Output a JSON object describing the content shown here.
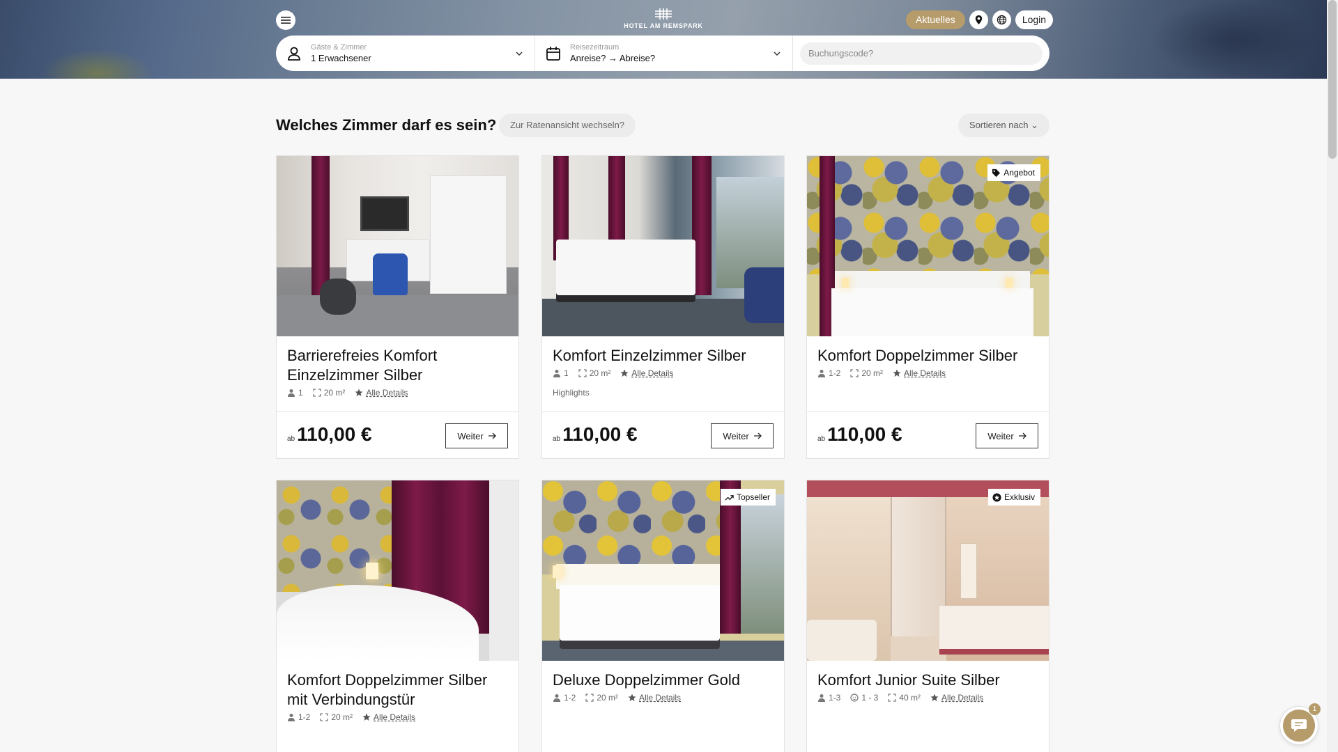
{
  "header": {
    "logo_text": "HOTEL AM REMSPARK",
    "aktuelles_label": "Aktuelles",
    "login_label": "Login",
    "accent_color": "#b69b6b"
  },
  "search": {
    "guests_label": "Gäste & Zimmer",
    "guests_value": "1 Erwachsener",
    "dates_label": "Reisezeitraum",
    "dates_value": "Anreise? → Abreise?",
    "code_placeholder": "Buchungscode?"
  },
  "main": {
    "title": "Welches Zimmer darf es sein?",
    "rate_toggle": "Zur Ratenansicht wechseln?",
    "sort_label": "Sortieren nach"
  },
  "rooms": [
    {
      "name": "Barrierefreies Komfort Einzelzimmer Silber",
      "guests": "1",
      "size": "20 m²",
      "details": "Alle Details",
      "highlights": "",
      "price_prefix": "ab",
      "price": "110,00 €",
      "button": "Weiter",
      "badge": ""
    },
    {
      "name": "Komfort Einzelzimmer Silber",
      "guests": "1",
      "size": "20 m²",
      "details": "Alle Details",
      "highlights": "Highlights",
      "price_prefix": "ab",
      "price": "110,00 €",
      "button": "Weiter",
      "badge": ""
    },
    {
      "name": "Komfort Doppelzimmer Silber",
      "guests": "1-2",
      "size": "20 m²",
      "details": "Alle Details",
      "highlights": "",
      "price_prefix": "ab",
      "price": "110,00 €",
      "button": "Weiter",
      "badge": "Angebot"
    },
    {
      "name": "Komfort Doppelzimmer Silber mit Verbindungstür",
      "guests": "1-2",
      "size": "20 m²",
      "details": "Alle Details",
      "highlights": "",
      "badge": ""
    },
    {
      "name": "Deluxe Doppelzimmer Gold",
      "guests": "1-2",
      "size": "20 m²",
      "details": "Alle Details",
      "highlights": "",
      "badge": "Topseller"
    },
    {
      "name": "Komfort Junior Suite Silber",
      "guests": "1-3",
      "children": "1 - 3",
      "size": "40 m²",
      "details": "Alle Details",
      "highlights": "",
      "badge": "Exklusiv"
    }
  ],
  "chat": {
    "count": "1"
  }
}
